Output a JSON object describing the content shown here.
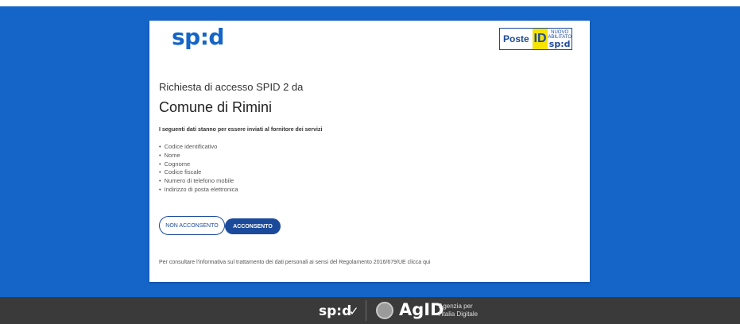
{
  "header": {
    "logo_text": "sp:d",
    "provider": {
      "name": "Poste",
      "id": "ID",
      "badge_top": "NUOVO",
      "badge_mid": "ABILITATO",
      "badge_spid": "sp:d"
    }
  },
  "request": {
    "label": "Richiesta di accesso SPID 2 da",
    "organization": "Comune di Rimini"
  },
  "data_intro": "I seguenti dati stanno per essere inviati al fornitore dei servizi",
  "attributes": [
    "Codice identificativo",
    "Nome",
    "Cognome",
    "Codice fiscale",
    "Numero di telefono mobile",
    "Indirizzo di posta elettronica"
  ],
  "buttons": {
    "deny": "NON ACCONSENTO",
    "accept": "ACCONSENTO"
  },
  "privacy_text": "Per consultare l'informativa sul trattamento dei dati personali ai sensi del Regolamento 2016/679/UE clicca qui",
  "footer": {
    "spid_logo": "sp:d",
    "check_mark": "✓",
    "agid_logo": "AgID",
    "agency_line1": "Agenzia per",
    "agency_line2": "l'Italia Digitale"
  },
  "colors": {
    "brand_blue": "#1565c8",
    "button_blue": "#1b4a9b",
    "footer_bg": "#3a3a3a",
    "poste_yellow": "#f5e400"
  }
}
